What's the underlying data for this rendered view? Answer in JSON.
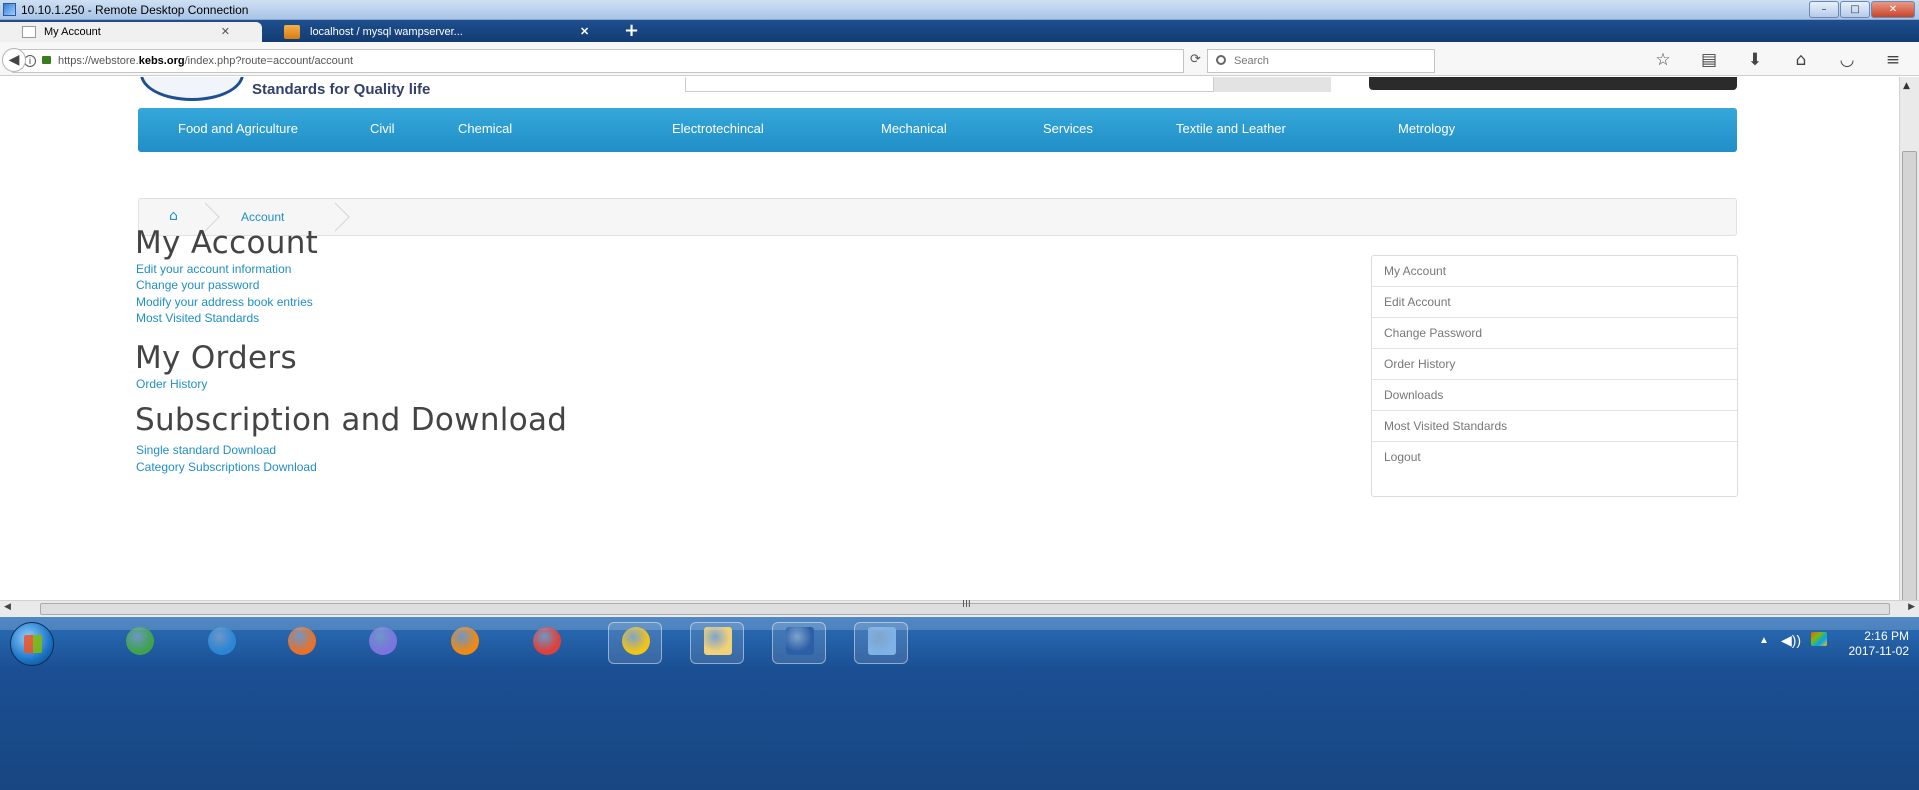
{
  "rdp": {
    "title": "10.10.1.250 - Remote Desktop Connection",
    "min": "–",
    "max": "□",
    "close": "✕"
  },
  "tabs": [
    {
      "label": "My Account",
      "close": "✕"
    },
    {
      "label": "localhost / mysql wampserver...",
      "close": "✕"
    }
  ],
  "new_tab": "+",
  "address": {
    "prefix": "https://webstore.",
    "domain": "kebs.org",
    "path": "/index.php?route=account/account",
    "info": "i"
  },
  "reload_icon": "⟳",
  "search": {
    "placeholder": "Search"
  },
  "toolbar_icons": [
    "star-icon",
    "reading-list-icon",
    "download-icon",
    "home-icon",
    "pocket-icon",
    "menu-icon"
  ],
  "toolbar_glyphs": [
    "☆",
    "▤",
    "⬇",
    "⌂",
    "◡",
    "≡"
  ],
  "site": {
    "tagline": "Standards for Quality life",
    "menu": [
      "Food and Agriculture",
      "Civil",
      "Chemical",
      "Electrotechincal",
      "Mechanical",
      "Services",
      "Textile and Leather",
      "Metrology"
    ],
    "breadcrumb": {
      "home_glyph": "⌂",
      "current": "Account"
    },
    "sections": [
      {
        "heading": "My Account",
        "links": [
          "Edit your account information",
          "Change your password",
          "Modify your address book entries",
          "Most Visited Standards"
        ]
      },
      {
        "heading": "My Orders",
        "links": [
          "Order History"
        ]
      },
      {
        "heading": "Subscription and Download",
        "links": [
          "Single standard Download",
          "Category Subscriptions Download"
        ]
      }
    ],
    "sidebar": [
      "My Account",
      "Edit Account",
      "Change Password",
      "Order History",
      "Downloads",
      "Most Visited Standards",
      "Logout"
    ]
  },
  "scroll_h_grip": "III",
  "taskbar": {
    "apps": [
      "ie-icon",
      "ie-edge-icon",
      "firefox-icon",
      "dolphin-icon",
      "vlc-icon",
      "photo-icon",
      "chrome-icon",
      "explorer-icon",
      "word-icon",
      "network-icon"
    ],
    "colors": [
      "#3fa34d",
      "#2b86d6",
      "#e8722a",
      "#7a74e0",
      "#f08a12",
      "#e0403a",
      "#f0c419",
      "#f2d277",
      "#2d5fa8",
      "#7fb2e5"
    ],
    "tray_arrow": "▲",
    "tray_volume": "◀))",
    "time": "2:16 PM",
    "date": "2017-11-02"
  }
}
